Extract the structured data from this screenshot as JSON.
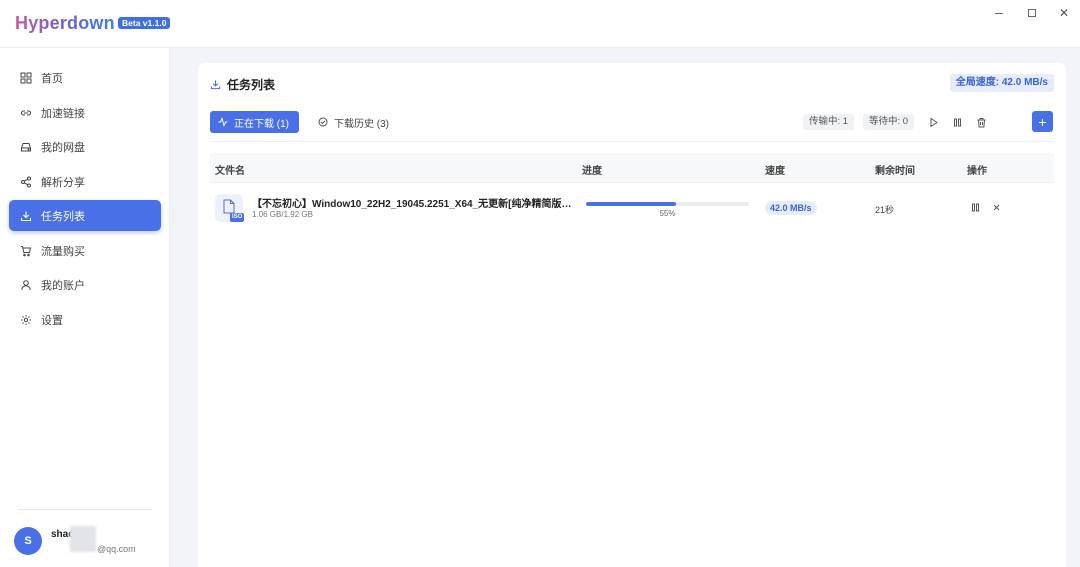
{
  "app": {
    "name": "Hyperdown",
    "version_badge": "Beta v1.1.0"
  },
  "sidebar": {
    "items": [
      {
        "label": "首页",
        "icon": "grid-icon"
      },
      {
        "label": "加速链接",
        "icon": "link-icon"
      },
      {
        "label": "我的网盘",
        "icon": "drive-icon"
      },
      {
        "label": "解析分享",
        "icon": "share-icon"
      },
      {
        "label": "任务列表",
        "icon": "download-icon",
        "active": true
      },
      {
        "label": "流量购买",
        "icon": "cart-icon"
      },
      {
        "label": "我的账户",
        "icon": "user-icon"
      },
      {
        "label": "设置",
        "icon": "gear-icon"
      }
    ],
    "user": {
      "avatar_letter": "S",
      "name": "shac",
      "email": "@qq.com"
    }
  },
  "main": {
    "title": "任务列表",
    "global_speed": "全局速度: 42.0 MB/s",
    "tabs": {
      "active": "正在下载 (1)",
      "history": "下载历史 (3)"
    },
    "stats": {
      "transferring": "传输中: 1",
      "waiting": "等待中: 0"
    },
    "table": {
      "headers": {
        "name": "文件名",
        "progress": "进度",
        "speed": "速度",
        "remaining": "剩余时间",
        "actions": "操作"
      },
      "rows": [
        {
          "file_type": "ISO",
          "name": "【不忘初心】Window10_22H2_19045.2251_X64_无更新[纯净精简版][1....",
          "size": "1.06 GB/1.92 GB",
          "progress": 55,
          "progress_label": "55%",
          "speed": "42.0 MB/s",
          "remaining": "21秒"
        }
      ]
    }
  },
  "colors": {
    "accent": "#4a70e8",
    "badge_bg": "#e7ecfb"
  }
}
